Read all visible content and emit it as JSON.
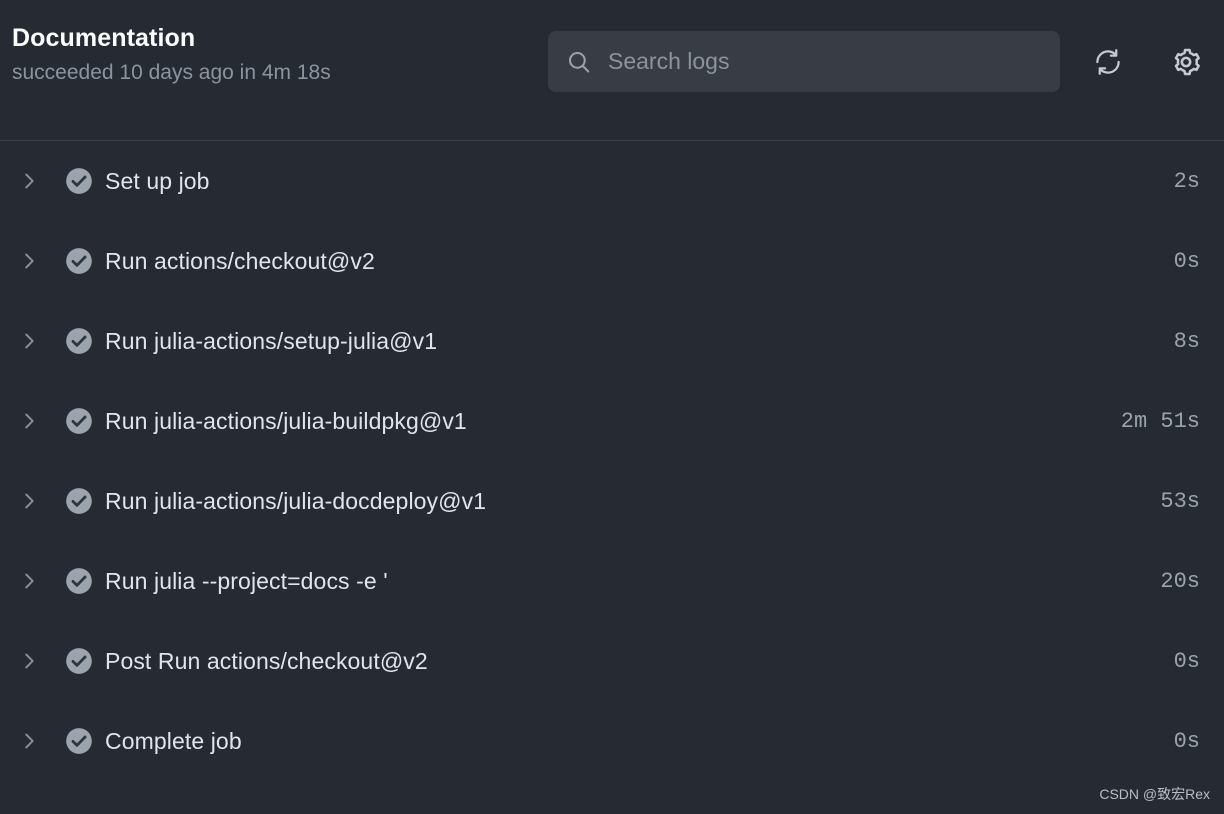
{
  "header": {
    "title": "Documentation",
    "subtitle": "succeeded 10 days ago in 4m 18s",
    "search": {
      "placeholder": "Search logs",
      "value": "",
      "icon": "search-icon"
    },
    "actions": [
      {
        "name": "refresh-button",
        "icon": "refresh-icon",
        "label": ""
      },
      {
        "name": "settings-button",
        "icon": "gear-icon",
        "label": ""
      }
    ]
  },
  "steps": [
    {
      "label": "Set up job",
      "duration": "2s",
      "status": "succeeded",
      "expand_icon": "chevron-right-icon",
      "status_icon": "check-circle-icon"
    },
    {
      "label": "Run actions/checkout@v2",
      "duration": "0s",
      "status": "succeeded",
      "expand_icon": "chevron-right-icon",
      "status_icon": "check-circle-icon"
    },
    {
      "label": "Run julia-actions/setup-julia@v1",
      "duration": "8s",
      "status": "succeeded",
      "expand_icon": "chevron-right-icon",
      "status_icon": "check-circle-icon"
    },
    {
      "label": "Run julia-actions/julia-buildpkg@v1",
      "duration": "2m 51s",
      "status": "succeeded",
      "expand_icon": "chevron-right-icon",
      "status_icon": "check-circle-icon"
    },
    {
      "label": "Run julia-actions/julia-docdeploy@v1",
      "duration": "53s",
      "status": "succeeded",
      "expand_icon": "chevron-right-icon",
      "status_icon": "check-circle-icon"
    },
    {
      "label": "Run julia --project=docs -e '",
      "duration": "20s",
      "status": "succeeded",
      "expand_icon": "chevron-right-icon",
      "status_icon": "check-circle-icon"
    },
    {
      "label": "Post Run actions/checkout@v2",
      "duration": "0s",
      "status": "succeeded",
      "expand_icon": "chevron-right-icon",
      "status_icon": "check-circle-icon"
    },
    {
      "label": "Complete job",
      "duration": "0s",
      "status": "succeeded",
      "expand_icon": "chevron-right-icon",
      "status_icon": "check-circle-icon"
    }
  ],
  "watermark": {
    "text": "CSDN @致宏Rex"
  },
  "colors": {
    "page_background": "#262b33",
    "search_background": "#373c45",
    "divider": "#3a404a",
    "title_text": "#ffffff",
    "muted_text": "#8b949e",
    "label_text": "#dfe5ec",
    "status_icon": "#9aa3ae"
  }
}
